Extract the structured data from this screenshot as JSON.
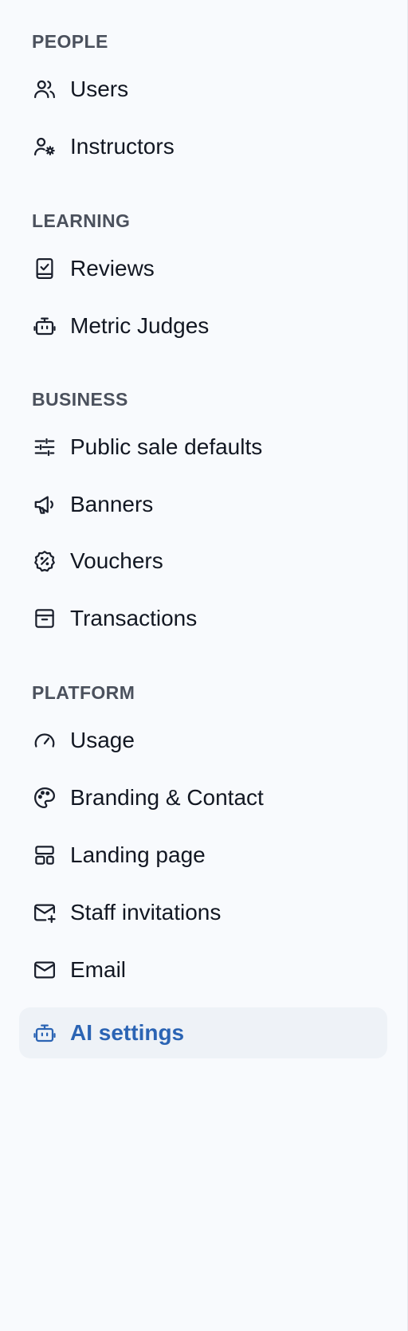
{
  "sidebar": {
    "sections": [
      {
        "title": "PEOPLE",
        "items": [
          {
            "label": "Users",
            "icon": "users-icon"
          },
          {
            "label": "Instructors",
            "icon": "user-settings-icon"
          }
        ]
      },
      {
        "title": "LEARNING",
        "items": [
          {
            "label": "Reviews",
            "icon": "clipboard-check-icon"
          },
          {
            "label": "Metric Judges",
            "icon": "robot-icon"
          }
        ]
      },
      {
        "title": "BUSINESS",
        "items": [
          {
            "label": "Public sale defaults",
            "icon": "sliders-icon"
          },
          {
            "label": "Banners",
            "icon": "megaphone-icon"
          },
          {
            "label": "Vouchers",
            "icon": "discount-badge-icon"
          },
          {
            "label": "Transactions",
            "icon": "archive-box-icon"
          }
        ]
      },
      {
        "title": "PLATFORM",
        "items": [
          {
            "label": "Usage",
            "icon": "gauge-icon"
          },
          {
            "label": "Branding & Contact",
            "icon": "palette-icon"
          },
          {
            "label": "Landing page",
            "icon": "layout-icon"
          },
          {
            "label": "Staff invitations",
            "icon": "mail-plus-icon"
          },
          {
            "label": "Email",
            "icon": "mail-icon"
          },
          {
            "label": "AI settings",
            "icon": "robot-icon",
            "active": true
          }
        ]
      }
    ]
  },
  "colors": {
    "background": "#f8fafd",
    "section_title": "#4b515d",
    "item_text": "#121722",
    "active_text": "#2b64b4",
    "active_background": "#eef2f7"
  }
}
